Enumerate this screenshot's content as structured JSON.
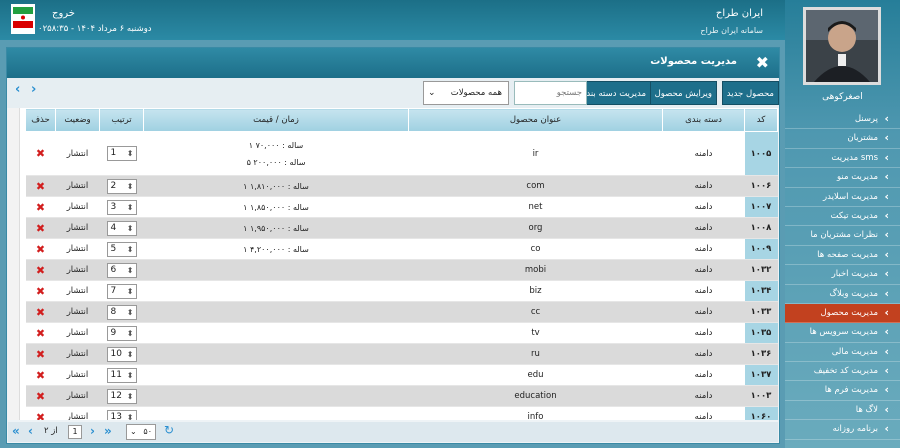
{
  "header": {
    "brand_title": "ایران طراح",
    "brand_sub": "سامانه ایران طراح",
    "logout": "خروج",
    "datestamp": "دوشنبه ۶ مرداد ۱۴۰۴ - ۰۲۵۸:۳۵"
  },
  "sidebar": {
    "username": "اصغرکوهی",
    "items": [
      {
        "label": "پرسنل"
      },
      {
        "label": "مشتریان"
      },
      {
        "label": "مدیریت sms"
      },
      {
        "label": "مدیریت منو"
      },
      {
        "label": "مدیریت اسلایدر"
      },
      {
        "label": "مدیریت تیکت"
      },
      {
        "label": "نظرات مشتریان ما"
      },
      {
        "label": "مدیریت صفحه ها"
      },
      {
        "label": "مدیریت اخبار"
      },
      {
        "label": "مدیریت وبلاگ"
      },
      {
        "label": "مدیریت محصول"
      },
      {
        "label": "مدیریت سرویس ها"
      },
      {
        "label": "مدیریت مالی"
      },
      {
        "label": "مدیریت کد تخفیف"
      },
      {
        "label": "مدیریت فرم ها"
      },
      {
        "label": "لاگ ها"
      },
      {
        "label": "برنامه روزانه"
      }
    ],
    "active_index": 10
  },
  "panel": {
    "title": "مدیریت محصولات"
  },
  "toolbar": {
    "new_product": "محصول جدید",
    "edit_product": "ویرایش محصول",
    "manage_category": "مدیریت دسته بندی",
    "search_placeholder": "جستجو",
    "category_select": "همه محصولات"
  },
  "table": {
    "headers": {
      "code": "کد",
      "category": "دسته بندی",
      "title": "عنوان محصول",
      "price": "زمان / قیمت",
      "order": "ترتیب",
      "status": "وضعیت",
      "delete": "حذف"
    },
    "rows": [
      {
        "code": "۱۰۰۵",
        "category": "دامنه",
        "title": "ir",
        "price": "۱ ساله : ۷۰,۰۰۰",
        "price2": "۵ ساله : ۲۰۰,۰۰۰",
        "order": "1",
        "status": "انتشار"
      },
      {
        "code": "۱۰۰۶",
        "category": "دامنه",
        "title": "com",
        "price": "۱ ساله : ۱,۸۱۰,۰۰۰",
        "price2": "",
        "order": "2",
        "status": "انتشار"
      },
      {
        "code": "۱۰۰۷",
        "category": "دامنه",
        "title": "net",
        "price": "۱ ساله : ۱,۸۵۰,۰۰۰",
        "price2": "",
        "order": "3",
        "status": "انتشار"
      },
      {
        "code": "۱۰۰۸",
        "category": "دامنه",
        "title": "org",
        "price": "۱ ساله : ۱,۹۵۰,۰۰۰",
        "price2": "",
        "order": "4",
        "status": "انتشار"
      },
      {
        "code": "۱۰۰۹",
        "category": "دامنه",
        "title": "co",
        "price": "۱ ساله : ۴,۲۰۰,۰۰۰",
        "price2": "",
        "order": "5",
        "status": "انتشار"
      },
      {
        "code": "۱۰۳۲",
        "category": "دامنه",
        "title": "mobi",
        "price": "",
        "price2": "",
        "order": "6",
        "status": "انتشار"
      },
      {
        "code": "۱۰۳۴",
        "category": "دامنه",
        "title": "biz",
        "price": "",
        "price2": "",
        "order": "7",
        "status": "انتشار"
      },
      {
        "code": "۱۰۳۳",
        "category": "دامنه",
        "title": "cc",
        "price": "",
        "price2": "",
        "order": "8",
        "status": "انتشار"
      },
      {
        "code": "۱۰۳۵",
        "category": "دامنه",
        "title": "tv",
        "price": "",
        "price2": "",
        "order": "9",
        "status": "انتشار"
      },
      {
        "code": "۱۰۳۶",
        "category": "دامنه",
        "title": "ru",
        "price": "",
        "price2": "",
        "order": "10",
        "status": "انتشار"
      },
      {
        "code": "۱۰۳۷",
        "category": "دامنه",
        "title": "edu",
        "price": "",
        "price2": "",
        "order": "11",
        "status": "انتشار"
      },
      {
        "code": "۱۰۰۳",
        "category": "دامنه",
        "title": "education",
        "price": "",
        "price2": "",
        "order": "12",
        "status": "انتشار"
      },
      {
        "code": "۱۰۶۰",
        "category": "دامنه",
        "title": "info",
        "price": "",
        "price2": "",
        "order": "13",
        "status": "انتشار"
      }
    ]
  },
  "footer": {
    "page_current": "1",
    "page_of": "از ۲",
    "page_size": "۵۰"
  },
  "colors": {
    "accent": "#1e6f8b",
    "active_nav": "#c2411f",
    "delete": "#d21e1e"
  }
}
